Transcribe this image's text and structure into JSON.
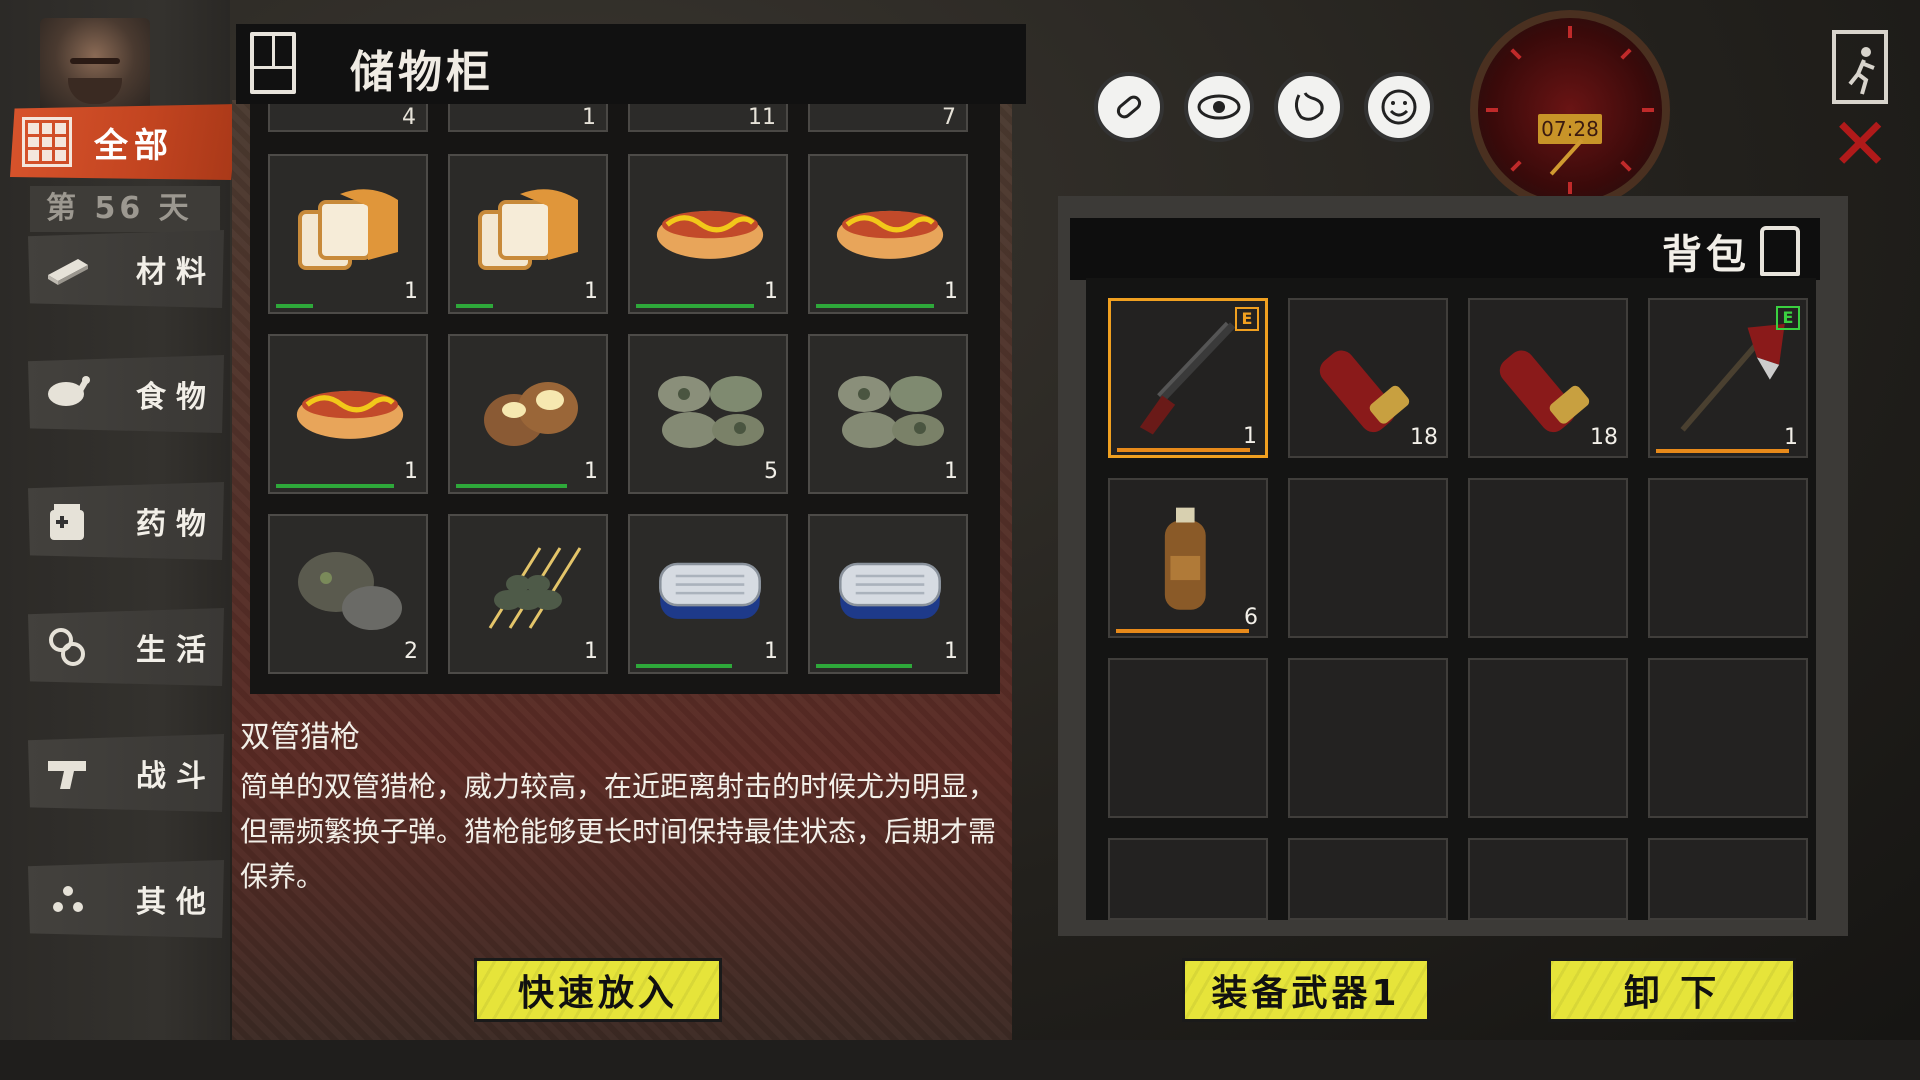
{
  "sidebar": {
    "all_label": "全部",
    "day_label": "第 56 天",
    "categories": [
      {
        "label": "材料",
        "icon": "material-icon"
      },
      {
        "label": "食物",
        "icon": "food-icon"
      },
      {
        "label": "药物",
        "icon": "medicine-icon"
      },
      {
        "label": "生活",
        "icon": "life-icon"
      },
      {
        "label": "战斗",
        "icon": "combat-icon"
      },
      {
        "label": "其他",
        "icon": "other-icon"
      }
    ]
  },
  "storage": {
    "title": "储物柜",
    "partial_row_qty": [
      "4",
      "1",
      "11",
      "7"
    ],
    "items": [
      {
        "name": "bread",
        "qty": "1",
        "durability": 0.25
      },
      {
        "name": "bread",
        "qty": "1",
        "durability": 0.25
      },
      {
        "name": "hotdog",
        "qty": "1",
        "durability": 0.8
      },
      {
        "name": "hotdog",
        "qty": "1",
        "durability": 0.8
      },
      {
        "name": "hotdog",
        "qty": "1",
        "durability": 0.8
      },
      {
        "name": "baked-potato",
        "qty": "1",
        "durability": 0.75
      },
      {
        "name": "moldy-food",
        "qty": "5",
        "durability": 0
      },
      {
        "name": "moldy-food",
        "qty": "1",
        "durability": 0
      },
      {
        "name": "rotten-potato",
        "qty": "2",
        "durability": 0
      },
      {
        "name": "skewers",
        "qty": "1",
        "durability": 0
      },
      {
        "name": "canned-fish",
        "qty": "1",
        "durability": 0.65
      },
      {
        "name": "canned-fish",
        "qty": "1",
        "durability": 0.65
      }
    ],
    "quick_store_label": "快速放入"
  },
  "description": {
    "title": "双管猎枪",
    "text": "简单的双管猎枪，威力较高，在近距离射击的时候尤为明显，但需频繁换子弹。猎枪能够更长时间保持最佳状态，后期才需保养。"
  },
  "status_icons": [
    "pill-icon",
    "eye-icon",
    "stomach-icon",
    "mood-icon"
  ],
  "clock": {
    "time": "07:28"
  },
  "backpack": {
    "title": "背包",
    "items": [
      {
        "name": "double-barrel-shotgun",
        "qty": "1",
        "tag": "E",
        "tag_color": "#f0a020",
        "durability": 0.9,
        "selected": true
      },
      {
        "name": "shotgun-shell",
        "qty": "18"
      },
      {
        "name": "shotgun-shell",
        "qty": "18"
      },
      {
        "name": "fire-axe",
        "qty": "1",
        "tag": "E",
        "tag_color": "#3ad040",
        "durability": 0.9
      },
      {
        "name": "gas-canister",
        "qty": "6",
        "durability": 0.9
      }
    ],
    "equip_label": "装备武器1",
    "unload_label": "卸 下"
  }
}
